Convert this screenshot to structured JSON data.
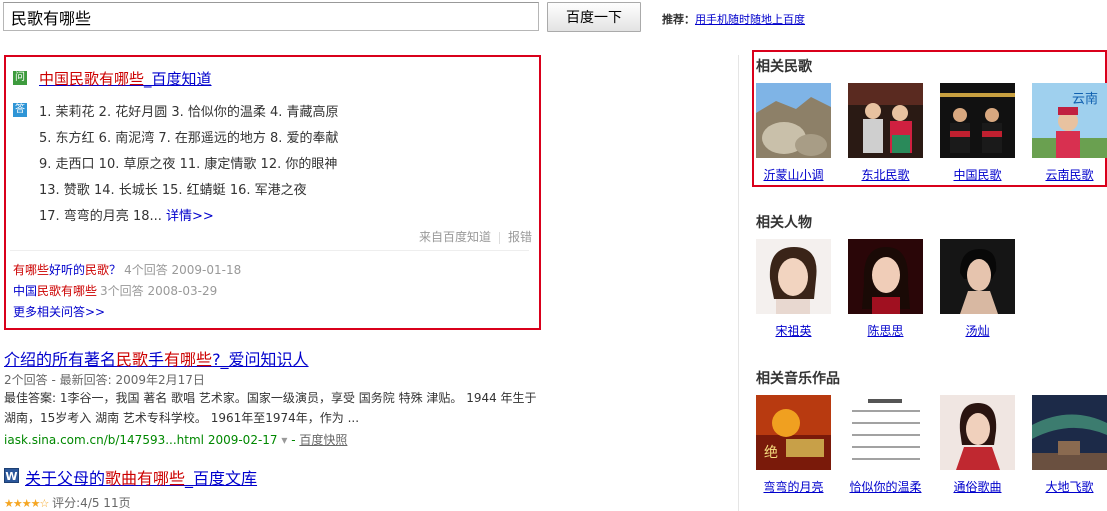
{
  "search": {
    "query": "民歌有哪些",
    "button": "百度一下"
  },
  "recommend": {
    "label": "推荐：",
    "link": "用手机随时随地上百度"
  },
  "zhidao": {
    "q_icon": "问",
    "a_icon": "答",
    "title_em": "中国民歌有哪些",
    "title_rest": "_百度知道",
    "answer_lines": [
      "1. 茉莉花 2. 花好月圆 3. 恰似你的温柔 4. 青藏高原",
      "5. 东方红 6. 南泥湾 7. 在那遥远的地方 8. 爱的奉献",
      "9. 走西口 10. 草原之夜 11. 康定情歌 12. 你的眼神",
      "13. 赞歌 14. 长城长 15. 红蜻蜓 16. 军港之夜",
      "17. 弯弯的月亮 18..."
    ],
    "more_detail": "详情>>",
    "source": "来自百度知道",
    "report": "报错",
    "related": [
      {
        "pre": "有哪些",
        "mid": "好听的",
        "em": "民歌",
        "post": "？",
        "meta": "4个回答 2009-01-18"
      },
      {
        "pre": "中国",
        "mid": "",
        "em": "民歌有哪些",
        "post": "",
        "meta": "3个回答 2008-03-29"
      }
    ],
    "more_related": "更多相关问答>>"
  },
  "results": [
    {
      "title_pre": "介绍的所有著名",
      "title_em": "民歌",
      "title_mid": "手",
      "title_em2": "有哪些",
      "title_post": "?_爱问知识人",
      "meta": "2个回答 - 最新回答: 2009年2月17日",
      "snippet": "最佳答案: 1李谷一，我国 著名 歌唱 艺术家。国家一级演员，享受 国务院 特殊 津贴。 1944 年生于湖南，15岁考入 湖南 艺术专科学校。 1961年至1974年，作为 ...",
      "url": "iask.sina.com.cn/b/147593...html 2009-02-17",
      "cache": "百度快照"
    },
    {
      "icon": "W",
      "title_pre": "关于父母的",
      "title_em": "歌曲有哪些",
      "title_post": "_百度文库",
      "rating": "评分:4/5 11页",
      "stars": "★★★★☆"
    }
  ],
  "sidebar": {
    "songs": {
      "title": "相关民歌",
      "items": [
        "沂蒙山小调",
        "东北民歌",
        "中国民歌",
        "云南民歌"
      ]
    },
    "people": {
      "title": "相关人物",
      "items": [
        "宋祖英",
        "陈思思",
        "汤灿"
      ]
    },
    "music": {
      "title": "相关音乐作品",
      "items": [
        "弯弯的月亮",
        "恰似你的温柔",
        "通俗歌曲",
        "大地飞歌"
      ]
    }
  },
  "colors": {
    "highlight_border": "#d9001b",
    "link": "#0000cc",
    "em": "#cc0000",
    "url": "#008000"
  }
}
